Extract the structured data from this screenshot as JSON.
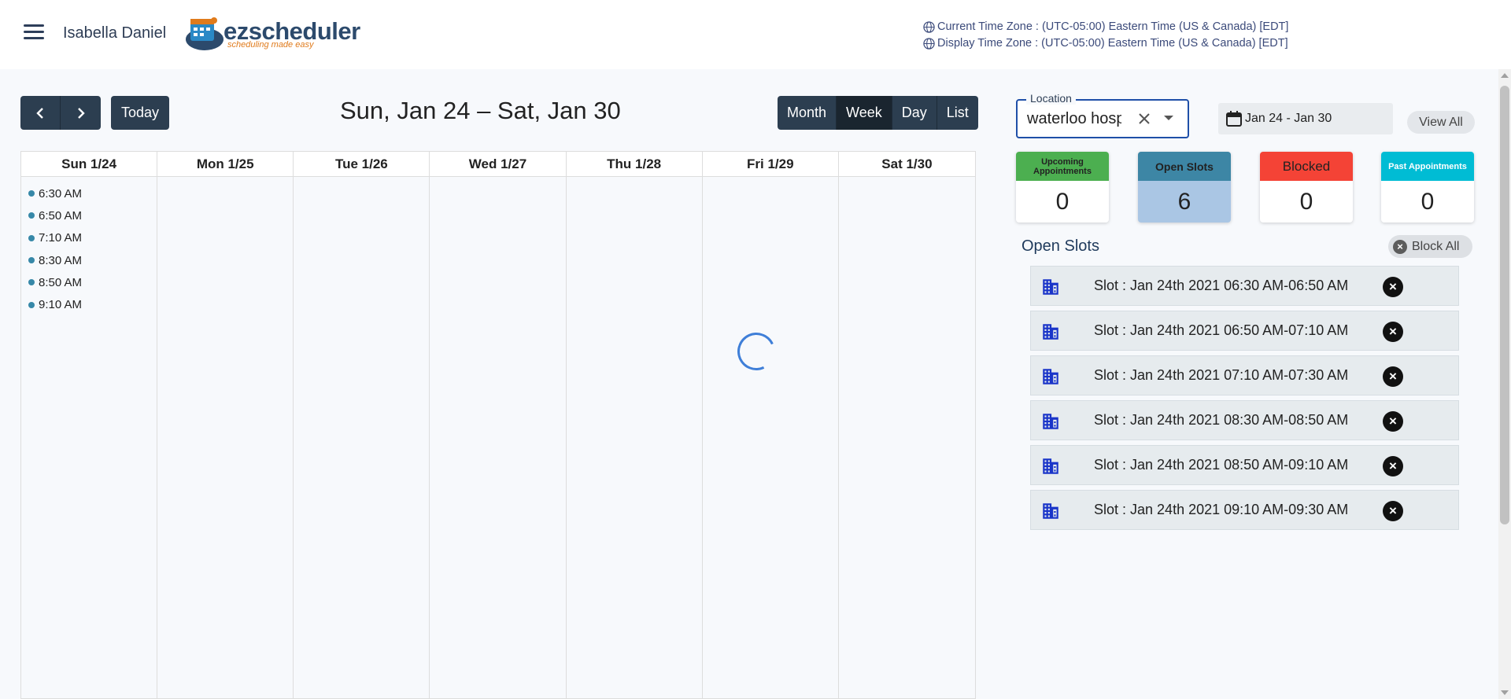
{
  "header": {
    "user_name": "Isabella Daniel",
    "logo_main": "ezscheduler",
    "logo_tagline": "scheduling made easy",
    "current_tz": "Current Time Zone : (UTC-05:00) Eastern Time (US & Canada) [EDT]",
    "display_tz": "Display Time Zone : (UTC-05:00) Eastern Time (US & Canada) [EDT]"
  },
  "toolbar": {
    "prev_icon": "chevron-left-icon",
    "next_icon": "chevron-right-icon",
    "today_label": "Today",
    "title": "Sun, Jan 24 – Sat, Jan 30",
    "views": [
      "Month",
      "Week",
      "Day",
      "List"
    ],
    "active_view": "Week"
  },
  "calendar": {
    "days": [
      "Sun 1/24",
      "Mon 1/25",
      "Tue 1/26",
      "Wed 1/27",
      "Thu 1/28",
      "Fri 1/29",
      "Sat 1/30"
    ],
    "sunday_events": [
      "6:30 AM",
      "6:50 AM",
      "7:10 AM",
      "8:30 AM",
      "8:50 AM",
      "9:10 AM"
    ],
    "event_color": "#3788a8"
  },
  "right_panel": {
    "location_label": "Location",
    "location_value": "waterloo hospital",
    "date_range": "Jan 24 - Jan 30",
    "view_all": "View All",
    "stats": [
      {
        "label": "Upcoming Appointments",
        "value": "0",
        "color": "#4caf50"
      },
      {
        "label": "Open Slots",
        "value": "6",
        "color": "#3d86a5"
      },
      {
        "label": "Blocked",
        "value": "0",
        "color": "#f44336"
      },
      {
        "label": "Past Appointments",
        "value": "0",
        "color": "#00bcd4"
      }
    ],
    "open_slots_title": "Open Slots",
    "block_all": "Block All",
    "slots": [
      "Slot : Jan 24th 2021 06:30 AM-06:50 AM",
      "Slot : Jan 24th 2021 06:50 AM-07:10 AM",
      "Slot : Jan 24th 2021 07:10 AM-07:30 AM",
      "Slot : Jan 24th 2021 08:30 AM-08:50 AM",
      "Slot : Jan 24th 2021 08:50 AM-09:10 AM",
      "Slot : Jan 24th 2021 09:10 AM-09:30 AM"
    ]
  }
}
